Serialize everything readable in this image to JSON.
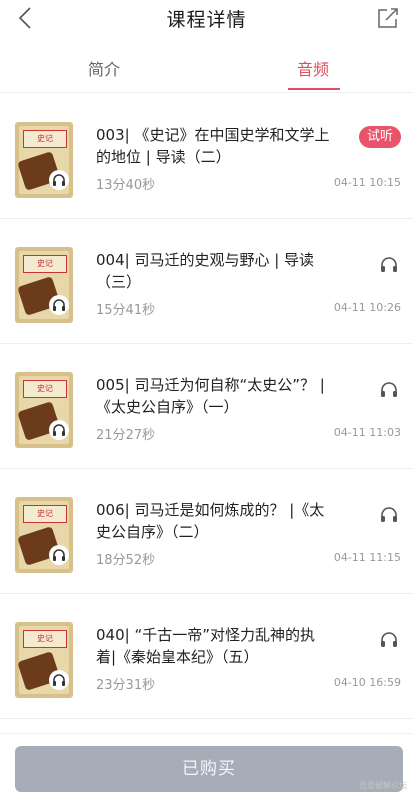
{
  "header": {
    "title": "课程详情"
  },
  "tabs": [
    {
      "label": "简介"
    },
    {
      "label": "音频"
    }
  ],
  "items": [
    {
      "title": "003| 《史记》在中国史学和文学上的地位 | 导读（二）",
      "duration": "13分40秒",
      "date": "04-11 10:15",
      "badge": "试听"
    },
    {
      "title": "004| 司马迁的史观与野心 | 导读（三）",
      "duration": "15分41秒",
      "date": "04-11 10:26"
    },
    {
      "title": "005| 司马迁为何自称“太史公”？ | 《太史公自序》（一）",
      "duration": "21分27秒",
      "date": "04-11 11:03"
    },
    {
      "title": "006| 司马迁是如何炼成的？ |《太史公自序》（二）",
      "duration": "18分52秒",
      "date": "04-11 11:15"
    },
    {
      "title": "040| “千古一帝”对怪力乱神的执着|《秦始皇本纪》（五）",
      "duration": "23分31秒",
      "date": "04-10 16:59"
    }
  ],
  "cover_label": "史记",
  "footer": {
    "buy_label": "已购买"
  },
  "watermark": "吾爱破解论坛",
  "colors": {
    "accent": "#e54d5e",
    "badge": "#e8546a",
    "button": "#a7adb8"
  }
}
